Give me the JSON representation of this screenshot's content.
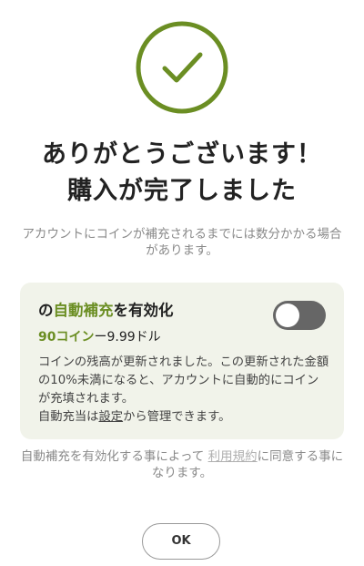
{
  "dialog": {
    "icon": "check-circle-icon",
    "title_line1": "ありがとうございます！",
    "title_line2": "購入が完了しました",
    "notice": "アカウントにコインが補充されるまでには数分かかる場合があります。"
  },
  "auto_refill": {
    "title_prefix": "の",
    "title_accent": "自動補充",
    "title_suffix": "を有効化",
    "coins": "90コイン",
    "price": "ー9.99ドル",
    "toggle_enabled": false,
    "desc_main": "コインの残高が更新されました。この更新された金額の10%未満になると、アカウントに自動的にコインが充填されます。",
    "desc_prefix": "自動充当は",
    "settings_link": "設定",
    "desc_suffix": "から管理できます。"
  },
  "terms": {
    "prefix": "自動補充を有効化する事によって",
    "link": "利用規約",
    "suffix": "に同意する事になります。"
  },
  "ok_button": {
    "label": "OK"
  },
  "colors": {
    "accent": "#6b8e23",
    "card_background": "#f1f3ea",
    "toggle_off": "#666666"
  }
}
